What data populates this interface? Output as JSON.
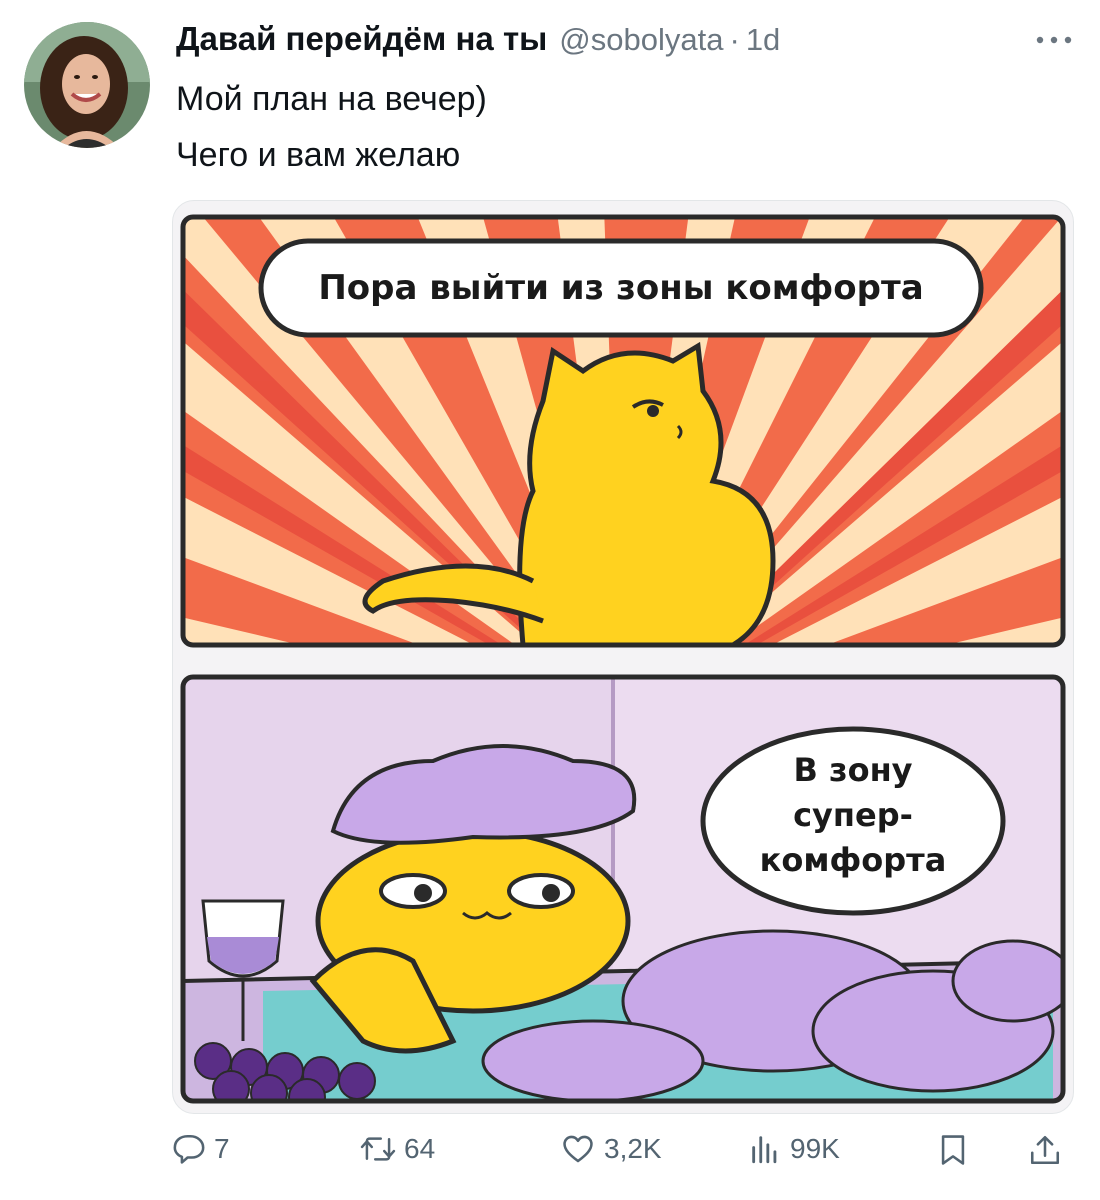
{
  "tweet": {
    "display_name": "Давай перейдём на ты",
    "handle": "@sobolyata",
    "separator": "·",
    "time": "1d",
    "lines": [
      "Мой план на вечер)",
      "Чего и вам желаю"
    ]
  },
  "comic": {
    "panel1_text": "Пора выйти из зоны комфорта",
    "panel2_lines": [
      "В зону",
      "супер-",
      "комфорта"
    ]
  },
  "actions": {
    "reply_count": "7",
    "retweet_count": "64",
    "like_count": "3,2K",
    "views_count": "99K"
  },
  "icons": [
    "more-icon",
    "reply-icon",
    "retweet-icon",
    "like-icon",
    "views-icon",
    "bookmark-icon",
    "share-icon"
  ],
  "colors": {
    "text": "#0f1419",
    "secondary": "#536471",
    "cat_yellow": "#ffd21f",
    "burst_red": "#e8413a",
    "foam_purple": "#c8a8e8"
  }
}
